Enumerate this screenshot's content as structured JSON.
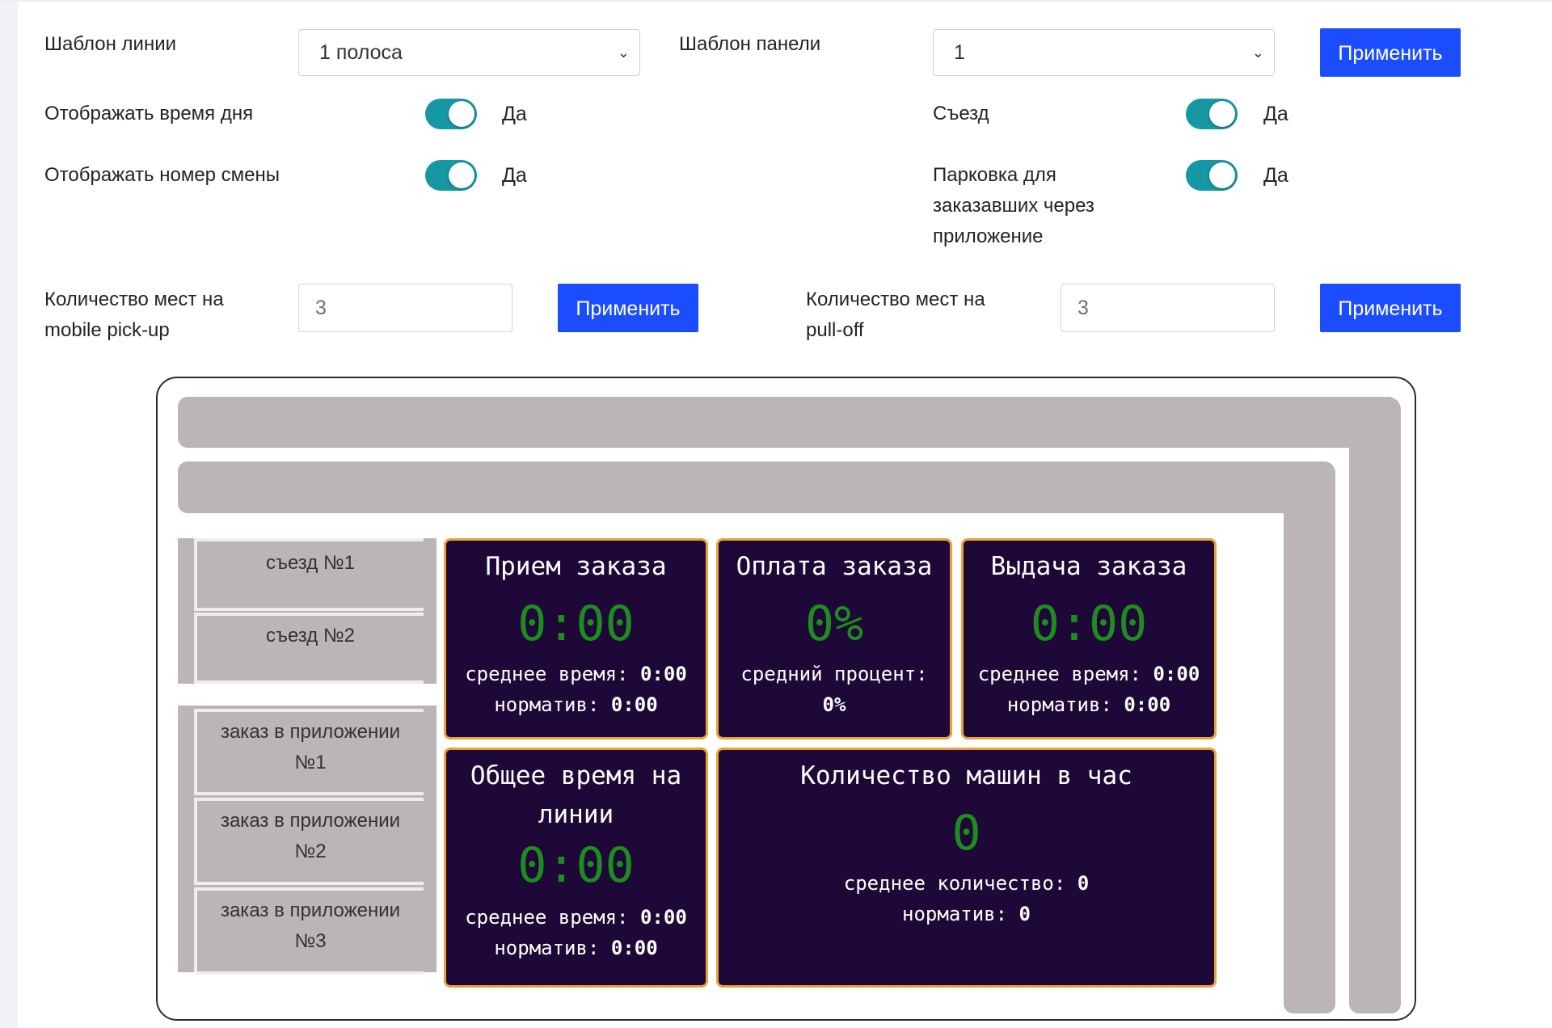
{
  "form": {
    "line_template_label": "Шаблон линии",
    "line_template_value": "1 полоса",
    "panel_template_label": "Шаблон панели",
    "panel_template_value": "1",
    "apply_label": "Применить",
    "show_time_label": "Отображать время дня",
    "show_time_value": "Да",
    "show_shift_label": "Отображать номер смены",
    "show_shift_value": "Да",
    "exit_label": "Съезд",
    "exit_value": "Да",
    "parking_label_1": "Парковка для",
    "parking_label_2": "заказавших через",
    "parking_label_3": "приложение",
    "parking_value": "Да",
    "mobile_places_label_1": "Количество мест на",
    "mobile_places_label_2": "mobile pick-up",
    "mobile_places_value": "3",
    "pulloff_places_label_1": "Количество мест на",
    "pulloff_places_label_2": "pull-off",
    "pulloff_places_value": "3"
  },
  "slots": {
    "exit_1": "съезд №1",
    "exit_2": "съезд №2",
    "app_line1": "заказ в приложении",
    "app_1": "№1",
    "app_2": "№2",
    "app_3": "№3"
  },
  "tiles": {
    "order_intake": {
      "title": "Прием заказа",
      "value": "0:00",
      "avg_label": "среднее время:",
      "avg_value": "0:00",
      "norm_label": "норматив:",
      "norm_value": "0:00"
    },
    "payment": {
      "title": "Оплата заказа",
      "value": "0%",
      "avg_label": "средний процент:",
      "avg_value": "0%"
    },
    "delivery": {
      "title": "Выдача заказа",
      "value": "0:00",
      "avg_label": "среднее время:",
      "avg_value": "0:00",
      "norm_label": "норматив:",
      "norm_value": "0:00"
    },
    "total_time": {
      "title_1": "Общее время на",
      "title_2": "линии",
      "value": "0:00",
      "avg_label": "среднее время:",
      "avg_value": "0:00",
      "norm_label": "норматив:",
      "norm_value": "0:00"
    },
    "cars_per_hour": {
      "title": "Количество машин в час",
      "value": "0",
      "avg_label": "среднее количество:",
      "avg_value": "0",
      "norm_label": "норматив:",
      "norm_value": "0"
    }
  },
  "colors": {
    "accent_button": "#1b4dff",
    "toggle_on": "#1597a4",
    "tile_bg": "#1e0837",
    "tile_border": "#e8a23c",
    "tile_value": "#1f8c1f",
    "road": "#bbb5b5"
  }
}
